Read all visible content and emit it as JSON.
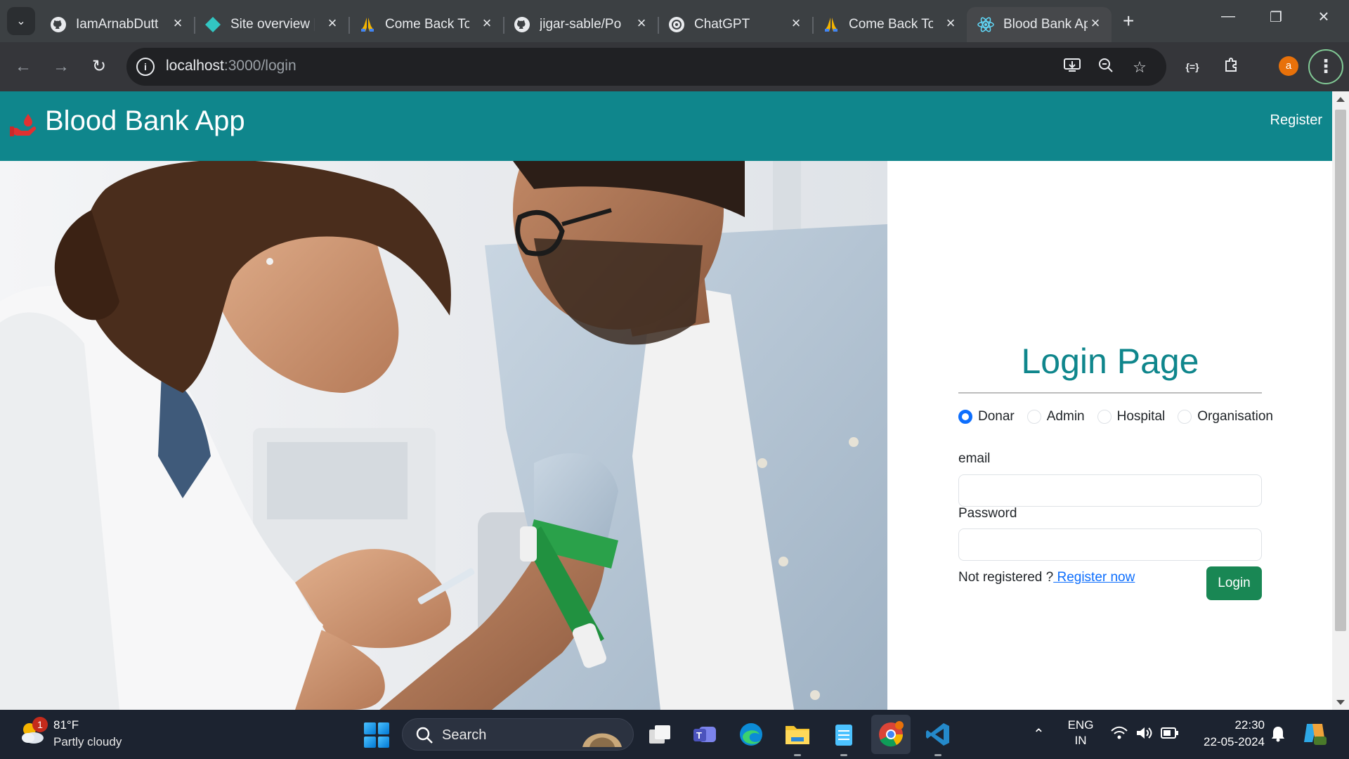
{
  "browser": {
    "tabs": [
      {
        "title": "IamArnabDutt",
        "icon": "github-icon"
      },
      {
        "title": "Site overview |",
        "icon": "netlify-icon"
      },
      {
        "title": "Come Back To",
        "icon": "praying-hands-icon"
      },
      {
        "title": "jigar-sable/Po",
        "icon": "github-icon"
      },
      {
        "title": "ChatGPT",
        "icon": "chatgpt-icon"
      },
      {
        "title": "Come Back To",
        "icon": "praying-hands-icon"
      },
      {
        "title": "Blood Bank Ap",
        "icon": "react-icon",
        "active": true
      }
    ],
    "url_host": "localhost",
    "url_path": ":3000/login",
    "profile_initial": "a"
  },
  "app": {
    "brand": "Blood Bank App",
    "nav_register": "Register",
    "login": {
      "title": "Login Page",
      "roles": [
        "Donar",
        "Admin",
        "Hospital",
        "Organisation"
      ],
      "selected_role": "Donar",
      "email_label": "email",
      "email_value": "",
      "password_label": "Password",
      "password_value": "",
      "not_registered": "Not registered ?",
      "register_link": " Register now",
      "login_button": "Login"
    }
  },
  "colors": {
    "navbar": "#0f868c",
    "title": "#0f868c",
    "login_button": "#198754",
    "link": "#0d6efd",
    "radio_checked": "#0d6efd"
  },
  "taskbar": {
    "weather_temp": "81°F",
    "weather_desc": "Partly cloudy",
    "weather_badge": "1",
    "search_placeholder": "Search",
    "lang_top": "ENG",
    "lang_bottom": "IN",
    "time": "22:30",
    "date": "22-05-2024"
  }
}
